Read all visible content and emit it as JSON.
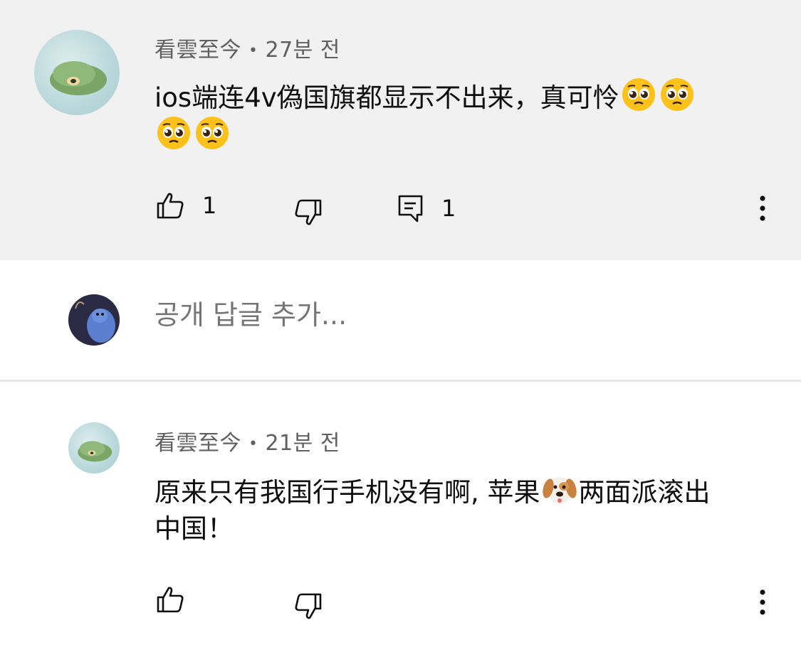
{
  "comments": [
    {
      "author": "看雲至今",
      "separator": "•",
      "time": "27분 전",
      "text_line1": "ios端连4v偽国旗都显示不出来，真可怜",
      "text_line2": "",
      "emoji_line1": [
        "pleading-face",
        "pleading-face"
      ],
      "emoji_line2": [
        "pleading-face",
        "pleading-face"
      ],
      "like_count": "1",
      "reply_count": "1"
    },
    {
      "author": "看雲至今",
      "separator": "•",
      "time": "21분 전",
      "text_line1_a": "原来只有我国行手机没有啊, 苹果",
      "text_line1_b": "两面派滚出",
      "text_line2": "中国！",
      "emoji_inline": "dog-face"
    }
  ],
  "reply_box": {
    "placeholder": "공개 답글 추가..."
  },
  "colors": {
    "highlight_bg": "#f1f1f1",
    "meta_text": "#606060",
    "body_text": "#0f0f0f",
    "placeholder_text": "#727272"
  }
}
